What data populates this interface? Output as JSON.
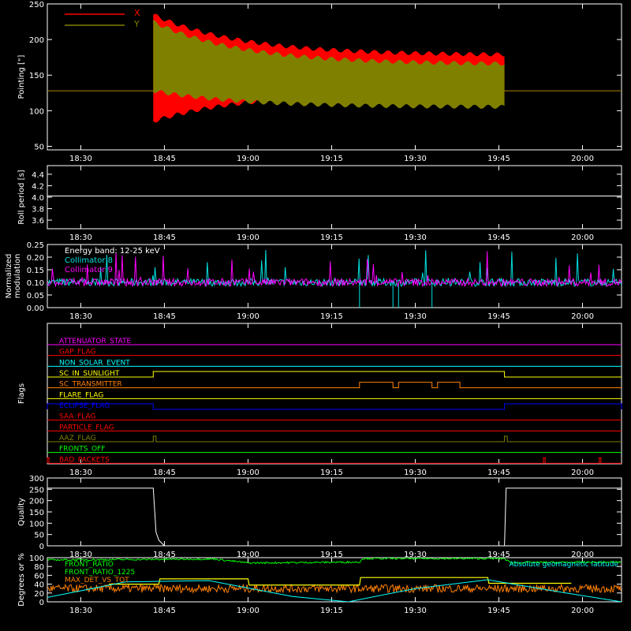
{
  "colors": {
    "background": "#000000",
    "axis": "#ffffff",
    "x_series": "#ff0000",
    "y_series": "#808000",
    "collimator8": "#00e0e0",
    "collimator9": "#ff00ff",
    "white": "#ffffff",
    "magenta": "#ff00ff",
    "red": "#ff0000",
    "cyan": "#00ffff",
    "orange": "#ff8000",
    "yellow": "#ffff00",
    "blue": "#0000ff",
    "olive": "#808000",
    "green": "#00ff00"
  },
  "time_axis": {
    "tick_labels": [
      "18:30",
      "18:45",
      "19:00",
      "19:15",
      "19:30",
      "19:45",
      "20:00"
    ]
  },
  "chart_data": [
    {
      "type": "line",
      "ylabel": "Pointing [\"]",
      "ylim": [
        45,
        250
      ],
      "yticks": [
        "50",
        "100",
        "150",
        "200",
        "250"
      ],
      "legend": {
        "position": "top-left",
        "entries": [
          "X",
          "Y"
        ]
      },
      "series": [
        {
          "name": "X",
          "color": "#ff0000",
          "baseline": 128,
          "active_window": [
            "18:43",
            "19:46"
          ],
          "envelope_start": [
            85,
            235
          ],
          "envelope_end": [
            125,
            178
          ]
        },
        {
          "name": "Y",
          "color": "#808000",
          "baseline": 128,
          "active_window": [
            "18:43",
            "19:46"
          ],
          "envelope_start": [
            128,
            225
          ],
          "envelope_end": [
            105,
            165
          ]
        }
      ]
    },
    {
      "type": "line",
      "ylabel": "Roll period [s]",
      "ylim": [
        3.45,
        4.55
      ],
      "yticks": [
        "3.6",
        "3.8",
        "4.0",
        "4.2",
        "4.4"
      ],
      "series": [
        {
          "name": "",
          "color": "#ffffff",
          "value": 4.02
        }
      ]
    },
    {
      "type": "line",
      "ylabel": "Normalized modulation",
      "ylim": [
        0,
        0.25
      ],
      "yticks": [
        "0.00",
        "0.05",
        "0.10",
        "0.15",
        "0.20",
        "0.25"
      ],
      "annotation": "Energy band: 12-25 keV",
      "legend": {
        "position": "top-left",
        "entries": [
          "Collimator 8",
          "Collimator 9"
        ]
      },
      "series": [
        {
          "name": "Collimator 8",
          "color": "#00e0e0",
          "mean": 0.1,
          "dropouts": [
            "19:20",
            "19:26",
            "19:27",
            "19:33"
          ]
        },
        {
          "name": "Collimator 9",
          "color": "#ff00ff",
          "mean": 0.1
        }
      ]
    },
    {
      "type": "step",
      "ylabel": "Flags",
      "flags": [
        {
          "name": "ATTENUATOR_STATE",
          "color": "#ff00ff",
          "high": []
        },
        {
          "name": "GAP_FLAG",
          "color": "#ff0000",
          "high": []
        },
        {
          "name": "NON_SOLAR_EVENT",
          "color": "#00ffff",
          "high": []
        },
        {
          "name": "SC_IN_SUNLIGHT",
          "color": "#ffff00",
          "high": [
            [
              "18:43",
              "19:46"
            ]
          ]
        },
        {
          "name": "SC_TRANSMITTER",
          "color": "#ff8000",
          "high": [
            [
              "19:20",
              "19:26"
            ],
            [
              "19:27",
              "19:33"
            ],
            [
              "19:34",
              "19:38"
            ]
          ]
        },
        {
          "name": "FLARE_FLAG",
          "color": "#ffff00",
          "high": []
        },
        {
          "name": "ECLIPSE_FLAG",
          "color": "#0000ff",
          "high": [
            [
              "18:24",
              "18:43"
            ],
            [
              "19:46",
              "20:07"
            ]
          ]
        },
        {
          "name": "SAA_FLAG",
          "color": "#ff0000",
          "high": []
        },
        {
          "name": "PARTICLE_FLAG",
          "color": "#ff0000",
          "high": []
        },
        {
          "name": "AAZ_FLAG",
          "color": "#808000",
          "high": [
            [
              "18:43",
              "18:43.5"
            ],
            [
              "19:46",
              "19:46.5"
            ]
          ]
        },
        {
          "name": "FRONTS_OFF",
          "color": "#00ff00",
          "high": []
        },
        {
          "name": "BAD_PACKETS",
          "color": "#ff0000",
          "high": [
            [
              "18:24",
              "18:24.3"
            ],
            [
              "19:53",
              "19:53.3"
            ],
            [
              "20:03",
              "20:03.3"
            ]
          ]
        }
      ]
    },
    {
      "type": "line",
      "ylabel": "Quality",
      "ylim": [
        0,
        300
      ],
      "yticks": [
        "0",
        "50",
        "100",
        "150",
        "200",
        "250",
        "300"
      ],
      "series": [
        {
          "name": "",
          "color": "#ffffff",
          "points": [
            [
              "18:24",
              255
            ],
            [
              "18:43",
              255
            ],
            [
              "18:43.5",
              60
            ],
            [
              "18:44",
              25
            ],
            [
              "18:45",
              0
            ],
            [
              "19:46",
              0
            ],
            [
              "19:46.3",
              255
            ],
            [
              "20:07",
              255
            ]
          ]
        }
      ]
    },
    {
      "type": "line",
      "ylabel": "Degrees or %",
      "ylim": [
        0,
        100
      ],
      "yticks": [
        "0",
        "20",
        "40",
        "60",
        "80",
        "100"
      ],
      "legend_left": {
        "entries": [
          {
            "name": "FRONT_RATIO",
            "color": "#00ff00"
          },
          {
            "name": "FRONT_RATIO_1225",
            "color": "#00ff00"
          },
          {
            "name": "MAX_DET_VS_TOT",
            "color": "#ff8000"
          }
        ]
      },
      "legend_right": {
        "entries": [
          {
            "name": "Absolute geomagnetic latitude",
            "color": "#00ffff"
          }
        ]
      },
      "series": [
        {
          "name": "FRONT_RATIO",
          "color": "#00ff00",
          "points": [
            [
              "18:24",
              95
            ],
            [
              "18:43",
              96
            ],
            [
              "18:54",
              97
            ],
            [
              "19:00",
              88
            ],
            [
              "19:20",
              90
            ],
            [
              "19:20.5",
              98
            ],
            [
              "19:46",
              98
            ],
            [
              "19:47",
              89
            ],
            [
              "20:07",
              90
            ]
          ]
        },
        {
          "name": "MAX_DET_VS_TOT",
          "color": "#ff8000",
          "mean": 30
        },
        {
          "name": "MAX_DET_VS_TOT_step",
          "color": "#ffff00",
          "points": [
            [
              "18:35",
              40
            ],
            [
              "18:44",
              40
            ],
            [
              "18:44.2",
              52
            ],
            [
              "19:00",
              52
            ],
            [
              "19:00.2",
              38
            ],
            [
              "19:20",
              38
            ],
            [
              "19:20.2",
              55
            ],
            [
              "19:43",
              55
            ],
            [
              "19:43.2",
              42
            ],
            [
              "19:58",
              42
            ]
          ]
        },
        {
          "name": "Absolute geomagnetic latitude",
          "color": "#00ffff",
          "points": [
            [
              "18:24",
              10
            ],
            [
              "18:38",
              45
            ],
            [
              "18:53",
              48
            ],
            [
              "19:08",
              12
            ],
            [
              "19:18",
              0
            ],
            [
              "19:30",
              30
            ],
            [
              "19:43",
              50
            ],
            [
              "19:57",
              20
            ],
            [
              "20:07",
              0
            ]
          ]
        }
      ]
    }
  ]
}
